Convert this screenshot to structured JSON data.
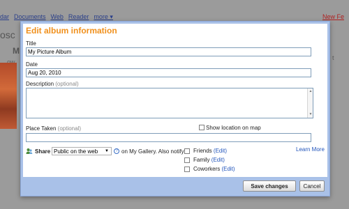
{
  "background": {
    "topbar_links": [
      "dar",
      "Documents",
      "Web",
      "Reader",
      "more ▾"
    ],
    "topbar_right": "New Fe",
    "side_fragments": [
      "osc",
      "M",
      "ow",
      "t"
    ]
  },
  "dialog": {
    "title": "Edit album information",
    "title_label": "Title",
    "title_value": "My Picture Album",
    "date_label": "Date",
    "date_value": "Aug 20, 2010",
    "description_label": "Description",
    "description_optional": "(optional)",
    "description_value": "",
    "place_label": "Place Taken",
    "place_optional": "(optional)",
    "place_value": "",
    "show_location_label": "Show location on map",
    "show_location_checked": false,
    "share_label": "Share",
    "share_selected": "Public on the web",
    "on_gallery_text": "on My Gallery. Also notify",
    "notify": [
      {
        "label": "Friends",
        "edit": "(Edit)",
        "checked": false
      },
      {
        "label": "Family",
        "edit": "(Edit)",
        "checked": false
      },
      {
        "label": "Coworkers",
        "edit": "(Edit)",
        "checked": false
      }
    ],
    "learn_more": "Learn More",
    "save_button": "Save changes",
    "cancel_button": "Cancel"
  },
  "colors": {
    "title": "#f0901c",
    "link": "#2255bb",
    "dialog_frame": "#a9c1e8"
  }
}
